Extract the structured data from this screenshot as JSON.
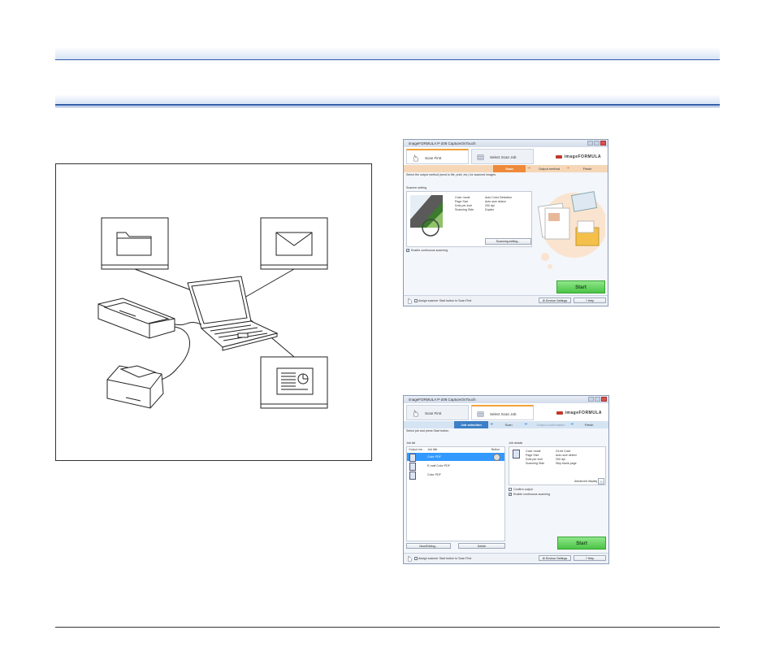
{
  "window_top": {
    "title": "imageFORMULA P-208 CaptureOnTouch",
    "tabs": [
      "Scan First",
      "Select Scan Job"
    ],
    "brand": "imageFORMULA",
    "steps": [
      "Scan",
      "Output method",
      "Finish"
    ],
    "instruction": "Select the output method (send to file, print, etc.) for scanned images.",
    "scanner_setting_label": "Scanner setting",
    "settings": [
      {
        "label": "Color mode",
        "value": "Auto Color Detection"
      },
      {
        "label": "Page Size",
        "value": "Auto size detect"
      },
      {
        "label": "Dots per inch",
        "value": "200 dpi"
      },
      {
        "label": "Scanning Side",
        "value": "Duplex"
      }
    ],
    "scanning_setting_button": "Scanning setting...",
    "continuous_label": "Enable continuous scanning",
    "start_button": "Start",
    "assign_label": "Assign scanner Start button to Scan First",
    "environ_button": "Environ Settings",
    "help_button": "Help"
  },
  "window_bottom": {
    "title": "imageFORMULA P-208 CaptureOnTouch",
    "tabs": [
      "Scan First",
      "Select Scan Job"
    ],
    "brand": "imageFORMULA",
    "steps": [
      "Job selection",
      "Scan",
      "Output confirmation",
      "Finish"
    ],
    "instruction": "Select job and press Start button.",
    "job_list_label": "Job list",
    "job_columns": [
      "Output me...",
      "Job title",
      "Button"
    ],
    "jobs": [
      "Color PDF",
      "E-mail Color PDF",
      "Color PDF"
    ],
    "job_details_label": "Job details",
    "details": [
      {
        "label": "Color mode",
        "value": "24-bit Color"
      },
      {
        "label": "Page Size",
        "value": "Auto size detect"
      },
      {
        "label": "Dots per inch",
        "value": "200 dpi"
      },
      {
        "label": "Scanning Side",
        "value": "Skip blank page"
      }
    ],
    "advanced_display": "Advanced display",
    "confirm_output": "Confirm output",
    "continuous_label": "Enable continuous scanning",
    "new_editing_button": "New/Editing...",
    "delete_button": "Delete",
    "start_button": "Start",
    "assign_label": "Assign scanner Start button to Scan First",
    "environ_button": "Environ Settings",
    "help_button": "Help"
  }
}
